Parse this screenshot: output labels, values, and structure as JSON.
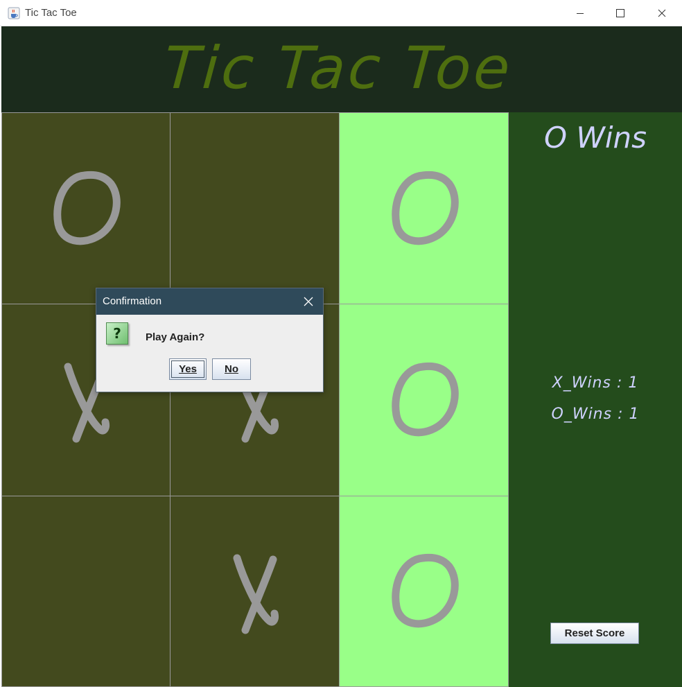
{
  "window": {
    "title": "Tic Tac Toe",
    "icon": "java-cup-icon"
  },
  "header": {
    "title": "Tic Tac Toe"
  },
  "board": {
    "cells": [
      {
        "mark": "O",
        "highlight": false
      },
      {
        "mark": "",
        "highlight": false
      },
      {
        "mark": "O",
        "highlight": true
      },
      {
        "mark": "X",
        "highlight": false
      },
      {
        "mark": "X",
        "highlight": false
      },
      {
        "mark": "O",
        "highlight": true
      },
      {
        "mark": "",
        "highlight": false
      },
      {
        "mark": "X",
        "highlight": false
      },
      {
        "mark": "O",
        "highlight": true
      }
    ]
  },
  "side_panel": {
    "status": "O Wins",
    "x_wins": "X_Wins : 1",
    "o_wins": "O_Wins : 1",
    "reset_label": "Reset Score"
  },
  "dialog": {
    "title": "Confirmation",
    "message": "Play Again?",
    "yes_label": "Yes",
    "no_label": "No",
    "icon": "question-icon"
  },
  "colors": {
    "header_bg": "#1b2b1c",
    "title_green": "#4e6e0f",
    "cell_dark": "#434a1e",
    "cell_win": "#99ff88",
    "panel_bg": "#244c1c",
    "mark_gray": "#999999",
    "dialog_title_bg": "#2f4a5a"
  }
}
